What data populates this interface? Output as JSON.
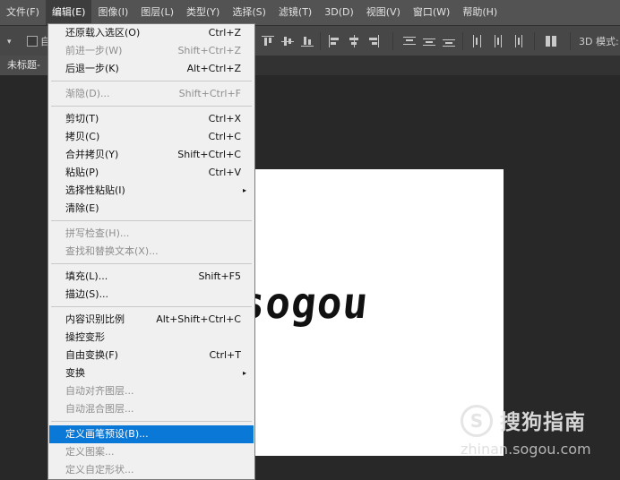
{
  "menubar": {
    "items": [
      "文件(F)",
      "编辑(E)",
      "图像(I)",
      "图层(L)",
      "类型(Y)",
      "选择(S)",
      "滤镜(T)",
      "3D(D)",
      "视图(V)",
      "窗口(W)",
      "帮助(H)"
    ],
    "active_index": 1
  },
  "options_bar": {
    "leading_glyph": "▾",
    "checkbox_label": "自",
    "mode_label": "3D 模式:"
  },
  "document_tab": {
    "title": "未标题-"
  },
  "canvas": {
    "text": "sogou"
  },
  "watermark": {
    "logo_letter": "S",
    "title": "搜狗指南",
    "url": "zhinan.sogou.com"
  },
  "edit_menu": {
    "items": [
      {
        "label": "还原载入选区(O)",
        "shortcut": "Ctrl+Z",
        "disabled": false
      },
      {
        "label": "前进一步(W)",
        "shortcut": "Shift+Ctrl+Z",
        "disabled": true
      },
      {
        "label": "后退一步(K)",
        "shortcut": "Alt+Ctrl+Z",
        "disabled": false
      },
      {
        "label": "渐隐(D)...",
        "shortcut": "Shift+Ctrl+F",
        "disabled": true
      },
      {
        "label": "剪切(T)",
        "shortcut": "Ctrl+X",
        "disabled": false
      },
      {
        "label": "拷贝(C)",
        "shortcut": "Ctrl+C",
        "disabled": false
      },
      {
        "label": "合并拷贝(Y)",
        "shortcut": "Shift+Ctrl+C",
        "disabled": false
      },
      {
        "label": "粘贴(P)",
        "shortcut": "Ctrl+V",
        "disabled": false
      },
      {
        "label": "选择性粘贴(I)",
        "shortcut": "",
        "disabled": false,
        "submenu": true
      },
      {
        "label": "清除(E)",
        "shortcut": "",
        "disabled": false
      },
      {
        "label": "拼写检查(H)...",
        "shortcut": "",
        "disabled": true
      },
      {
        "label": "查找和替换文本(X)...",
        "shortcut": "",
        "disabled": true
      },
      {
        "label": "填充(L)...",
        "shortcut": "Shift+F5",
        "disabled": false
      },
      {
        "label": "描边(S)...",
        "shortcut": "",
        "disabled": false
      },
      {
        "label": "内容识别比例",
        "shortcut": "Alt+Shift+Ctrl+C",
        "disabled": false
      },
      {
        "label": "操控变形",
        "shortcut": "",
        "disabled": false
      },
      {
        "label": "自由变换(F)",
        "shortcut": "Ctrl+T",
        "disabled": false
      },
      {
        "label": "变换",
        "shortcut": "",
        "disabled": false,
        "submenu": true
      },
      {
        "label": "自动对齐图层...",
        "shortcut": "",
        "disabled": true
      },
      {
        "label": "自动混合图层...",
        "shortcut": "",
        "disabled": true
      },
      {
        "label": "定义画笔预设(B)...",
        "shortcut": "",
        "disabled": false,
        "highlighted": true
      },
      {
        "label": "定义图案...",
        "shortcut": "",
        "disabled": true
      },
      {
        "label": "定义自定形状...",
        "shortcut": "",
        "disabled": true
      }
    ],
    "submenu_glyph": "▸"
  }
}
